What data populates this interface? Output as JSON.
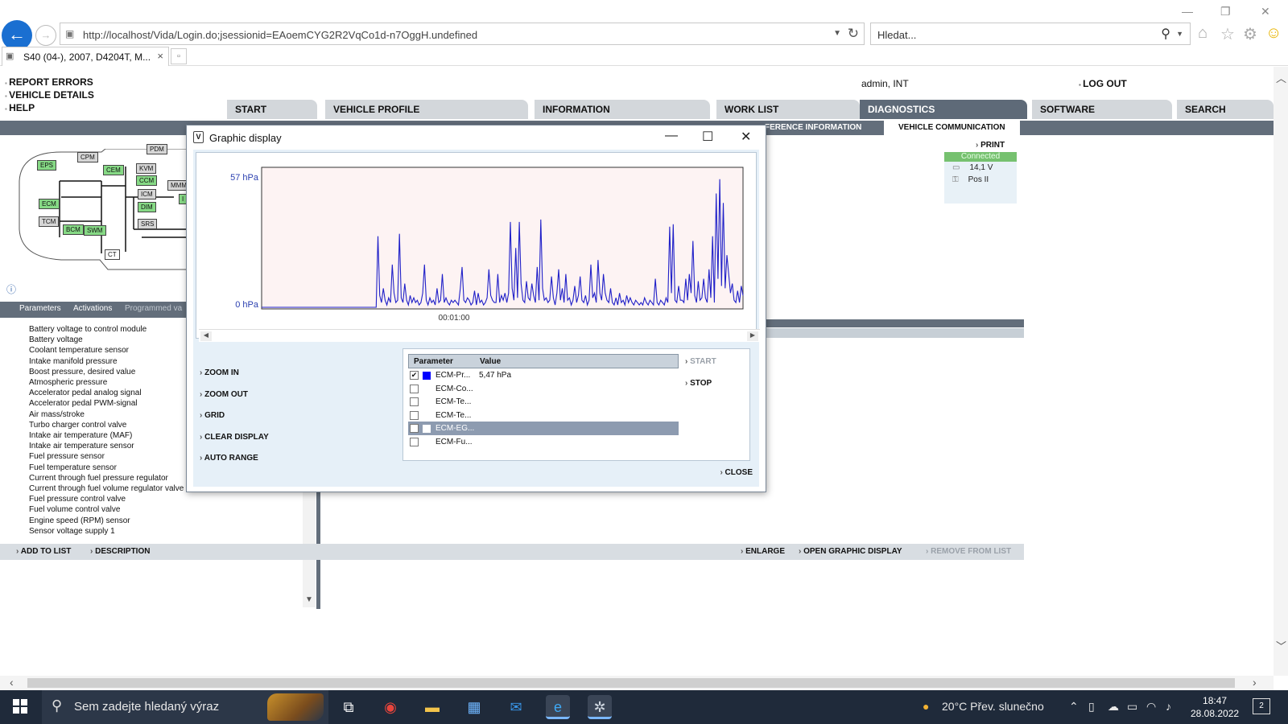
{
  "browser": {
    "url": "http://localhost/Vida/Login.do;jsessionid=EAoemCYG2R2VqCo1d-n7OggH.undefined",
    "search_placeholder": "Hledat...",
    "tab_title": "S40 (04-), 2007, D4204T, M...",
    "tab_close": "×"
  },
  "header": {
    "side_links": [
      "REPORT ERRORS",
      "VEHICLE DETAILS",
      "HELP"
    ],
    "user": "admin, INT",
    "logout": "LOG OUT"
  },
  "main_tabs": [
    "START",
    "VEHICLE PROFILE",
    "INFORMATION",
    "WORK LIST",
    "DIAGNOSTICS",
    "SOFTWARE",
    "SEARCH"
  ],
  "sub_tabs": {
    "reference": "FERENCE INFORMATION",
    "vehicle_comm": "VEHICLE COMMUNICATION"
  },
  "status": {
    "print": "PRINT",
    "connected": "Connected",
    "voltage": "14,1 V",
    "ignition": "Pos II"
  },
  "diagram": {
    "modules": [
      "EPS",
      "CPM",
      "CEM",
      "PDM",
      "KVM",
      "CCM",
      "MMM",
      "ICM",
      "DIM",
      "SRS",
      "ECM",
      "TCM",
      "BCM",
      "SWM",
      "CT",
      "I"
    ]
  },
  "left_panel": {
    "tabs": [
      "Parameters",
      "Activations",
      "Programmed va"
    ],
    "parameters": [
      "Battery voltage to control module",
      "Battery voltage",
      "Coolant temperature sensor",
      "Intake manifold pressure",
      "Boost pressure, desired value",
      "Atmospheric pressure",
      "Accelerator pedal analog signal",
      "Accelerator pedal PWM-signal",
      "Air mass/stroke",
      "Turbo charger control valve",
      "Intake air temperature (MAF)",
      "Intake air temperature sensor",
      "Fuel pressure sensor",
      "Fuel temperature sensor",
      "Current through fuel pressure regulator",
      "Current through fuel volume regulator valve",
      "Fuel pressure control valve",
      "Fuel volume control valve",
      "Engine speed (RPM) sensor",
      "Sensor voltage supply 1"
    ]
  },
  "bottom_bar": {
    "add_to_list": "ADD TO LIST",
    "description": "DESCRIPTION",
    "enlarge": "ENLARGE",
    "open_graphic": "OPEN GRAPHIC DISPLAY",
    "remove": "REMOVE FROM LIST"
  },
  "dialog": {
    "title": "Graphic display",
    "controls": [
      "ZOOM IN",
      "ZOOM OUT",
      "GRID",
      "CLEAR DISPLAY",
      "AUTO RANGE"
    ],
    "start": "START",
    "stop": "STOP",
    "close": "CLOSE",
    "legend": {
      "col_param": "Parameter",
      "col_value": "Value",
      "rows": [
        {
          "name": "ECM-Pr...",
          "value": "5,47 hPa",
          "checked": true,
          "color": "#0000ff"
        },
        {
          "name": "ECM-Co...",
          "value": "",
          "checked": false,
          "color": ""
        },
        {
          "name": "ECM-Te...",
          "value": "",
          "checked": false,
          "color": ""
        },
        {
          "name": "ECM-Te...",
          "value": "",
          "checked": false,
          "color": ""
        },
        {
          "name": "ECM-EG...",
          "value": "",
          "checked": false,
          "color": "#ffffff"
        },
        {
          "name": "ECM-Fu...",
          "value": "",
          "checked": false,
          "color": ""
        }
      ]
    }
  },
  "chart_data": {
    "type": "line",
    "y_ticks": [
      "57 hPa",
      "0 hPa"
    ],
    "x_tick": "00:01:00",
    "ylim": [
      0,
      57
    ],
    "line_color": "#2020c8",
    "plot_background": "#fdf3f3",
    "series": [
      {
        "values": [
          0,
          0,
          0,
          0,
          0,
          0,
          0,
          0,
          0,
          0,
          0,
          0,
          0,
          0,
          0,
          0,
          0,
          0,
          0,
          0,
          0,
          0,
          0,
          0,
          0,
          0,
          0,
          0,
          0,
          0,
          0,
          0,
          0,
          0,
          0,
          0,
          0,
          0,
          0,
          0,
          0,
          0,
          0,
          0,
          0,
          0,
          0,
          0,
          0,
          0,
          0,
          0,
          0,
          0,
          0,
          0,
          0,
          0,
          0,
          0,
          0,
          0,
          0,
          0,
          0,
          30,
          5,
          2,
          8,
          3,
          1,
          4,
          2,
          18,
          6,
          2,
          3,
          31,
          4,
          2,
          10,
          3,
          1,
          5,
          2,
          4,
          2,
          3,
          1,
          2,
          6,
          18,
          3,
          1,
          4,
          2,
          3,
          1,
          8,
          2,
          3,
          14,
          2,
          4,
          2,
          1,
          3,
          2,
          3,
          2,
          1,
          8,
          17,
          3,
          2,
          4,
          3,
          1,
          2,
          7,
          1,
          6,
          2,
          3,
          1,
          2,
          4,
          16,
          5,
          3,
          2,
          2,
          14,
          2,
          5,
          3,
          6,
          2,
          6,
          36,
          8,
          3,
          25,
          4,
          36,
          10,
          3,
          2,
          11,
          4,
          3,
          10,
          5,
          2,
          17,
          3,
          37,
          8,
          3,
          4,
          2,
          3,
          13,
          4,
          1,
          6,
          16,
          3,
          8,
          2,
          14,
          3,
          4,
          1,
          3,
          9,
          2,
          5,
          13,
          3,
          2,
          5,
          1,
          3,
          18,
          4,
          6,
          2,
          20,
          6,
          3,
          14,
          6,
          3,
          2,
          8,
          2,
          1,
          4,
          1,
          6,
          2,
          3,
          1,
          5,
          2,
          4,
          2,
          1,
          3,
          2,
          1,
          2,
          1,
          4,
          2,
          1,
          3,
          2,
          1,
          12,
          2,
          1,
          3,
          2,
          1,
          4,
          2,
          34,
          6,
          35,
          3,
          2,
          9,
          3,
          3,
          2,
          12,
          3,
          14,
          6,
          28,
          5,
          2,
          11,
          3,
          4,
          12,
          4,
          2,
          16,
          4,
          30,
          2,
          48,
          12,
          54,
          9,
          44,
          8,
          22,
          14,
          6,
          10,
          3,
          2,
          7,
          2,
          9,
          5
        ]
      }
    ]
  },
  "taskbar": {
    "search_placeholder": "Sem zadejte hledaný výraz",
    "weather": "20°C  Přev. slunečno",
    "time": "18:47",
    "date": "28.08.2022",
    "notifications": "2"
  }
}
